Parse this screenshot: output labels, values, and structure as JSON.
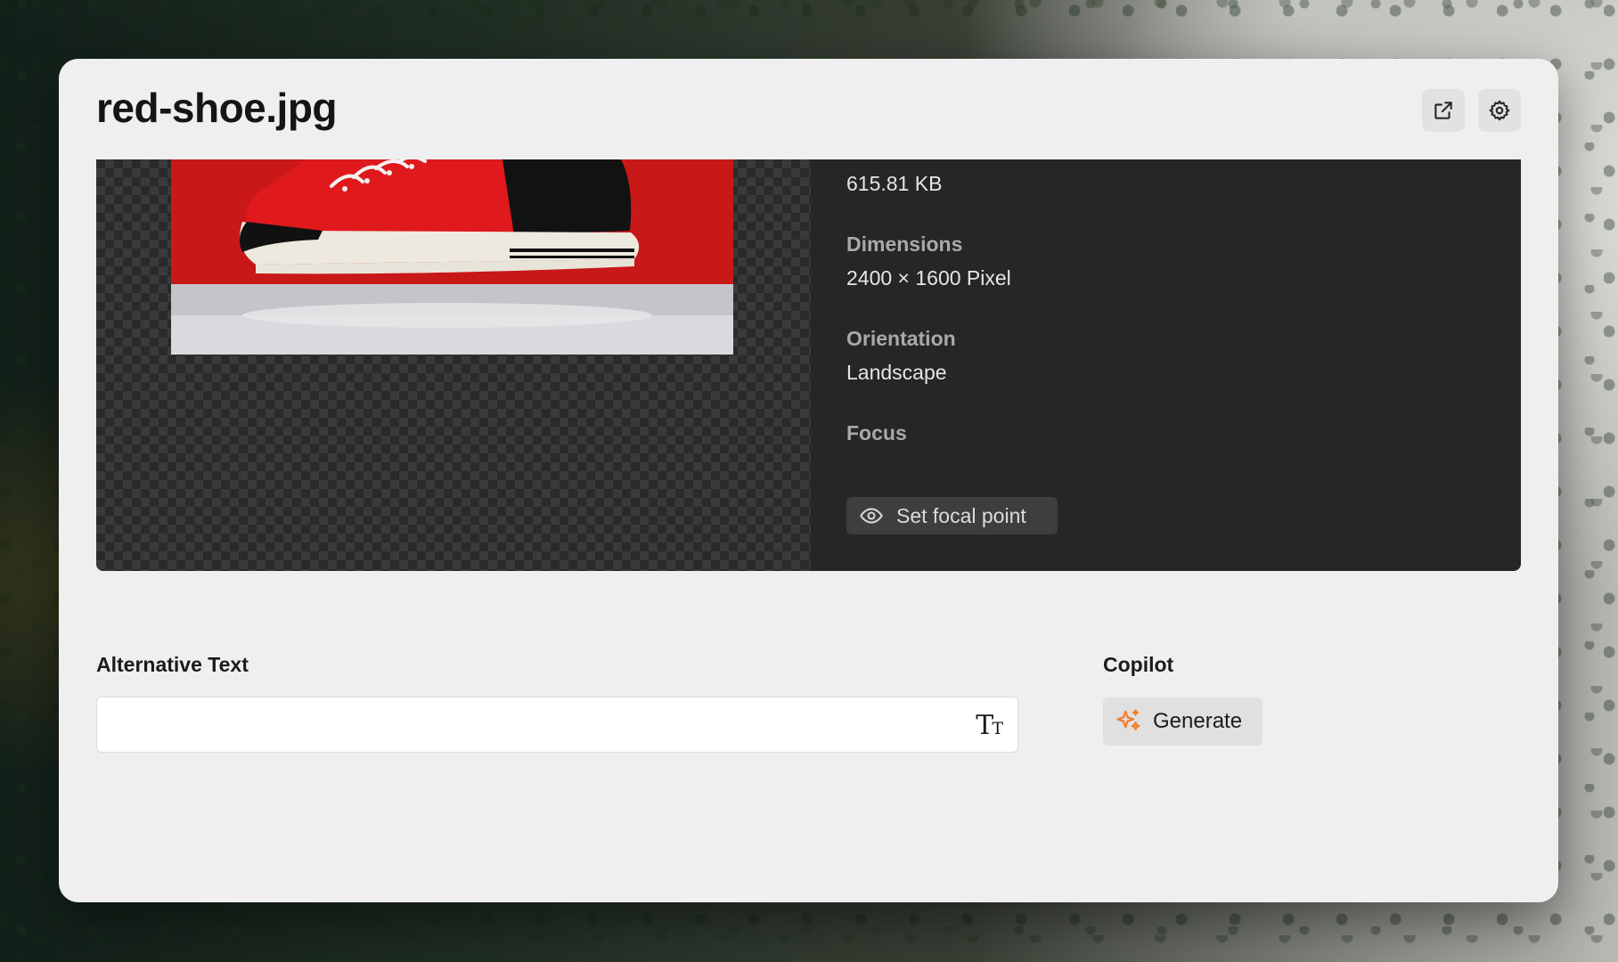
{
  "dialog": {
    "title": "red-shoe.jpg",
    "actions": {
      "open_icon": "external-link-icon",
      "settings_icon": "gear-icon"
    }
  },
  "media": {
    "size_value": "615.81 KB",
    "dimensions_label": "Dimensions",
    "dimensions_value": "2400 × 1600 Pixel",
    "orientation_label": "Orientation",
    "orientation_value": "Landscape",
    "focus_label": "Focus",
    "focal_button_label": "Set focal point"
  },
  "alt_text": {
    "label": "Alternative Text",
    "value": "",
    "text_style_icon": "text-size-icon"
  },
  "copilot": {
    "label": "Copilot",
    "generate_label": "Generate",
    "generate_icon": "sparkle-icon"
  },
  "colors": {
    "accent": "#f07f2e",
    "panel_dark": "#262626",
    "dialog_bg": "#efefef"
  }
}
